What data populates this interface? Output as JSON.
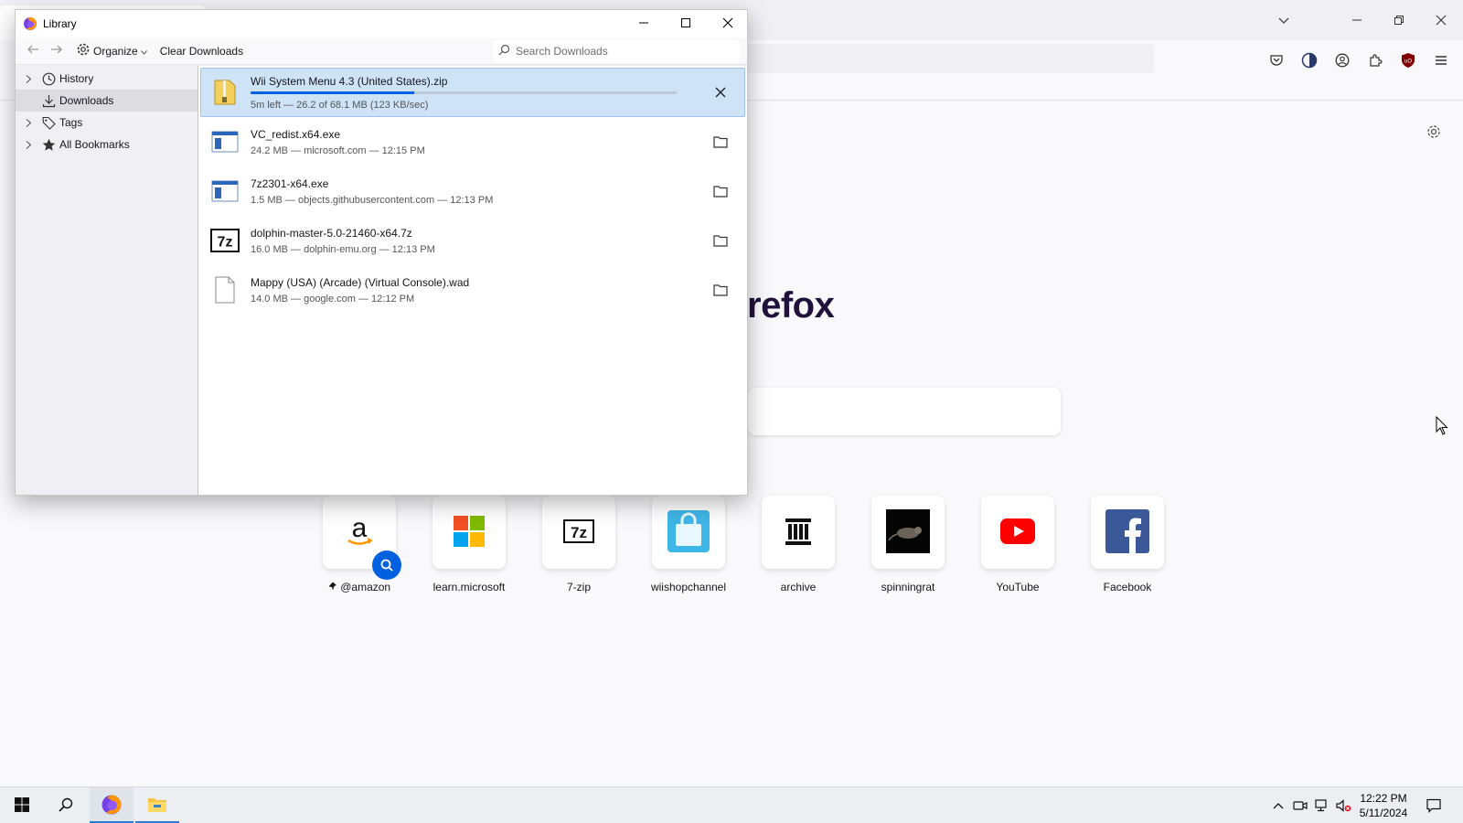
{
  "browser": {
    "logo_text": "refox",
    "shortcuts": [
      {
        "label": "@amazon",
        "icon": "amazon-logo-icon",
        "pinned": true
      },
      {
        "label": "learn.microsoft",
        "icon": "microsoft-logo-icon"
      },
      {
        "label": "7-zip",
        "icon": "7zip-logo-icon"
      },
      {
        "label": "wiishopchannel",
        "icon": "shopping-bag-icon"
      },
      {
        "label": "archive",
        "icon": "archive-building-icon"
      },
      {
        "label": "spinningrat",
        "icon": "rat-image-icon"
      },
      {
        "label": "YouTube",
        "icon": "youtube-logo-icon"
      },
      {
        "label": "Facebook",
        "icon": "facebook-logo-icon"
      }
    ]
  },
  "library": {
    "title": "Library",
    "toolbar": {
      "organize_label": "Organize",
      "clear_label": "Clear Downloads",
      "search_placeholder": "Search Downloads"
    },
    "sidebar": [
      {
        "label": "History",
        "icon": "clock-icon",
        "expandable": true
      },
      {
        "label": "Downloads",
        "icon": "download-icon",
        "expandable": false,
        "selected": true
      },
      {
        "label": "Tags",
        "icon": "tag-icon",
        "expandable": true
      },
      {
        "label": "All Bookmarks",
        "icon": "star-icon",
        "expandable": true
      }
    ],
    "downloads": [
      {
        "name": "Wii System Menu 4.3 (United States).zip",
        "status": "5m left — 26.2 of 68.1 MB (123 KB/sec)",
        "progress": 0.385,
        "icon": "zip-file-icon",
        "active": true
      },
      {
        "name": "VC_redist.x64.exe",
        "status": "24.2 MB — microsoft.com — 12:15 PM",
        "icon": "exe-file-icon"
      },
      {
        "name": "7z2301-x64.exe",
        "status": "1.5 MB — objects.githubusercontent.com — 12:13 PM",
        "icon": "exe-file-icon"
      },
      {
        "name": "dolphin-master-5.0-21460-x64.7z",
        "status": "16.0 MB — dolphin-emu.org — 12:13 PM",
        "icon": "7z-file-icon"
      },
      {
        "name": "Mappy (USA) (Arcade) (Virtual Console).wad",
        "status": "14.0 MB — google.com — 12:12 PM",
        "icon": "blank-file-icon"
      }
    ]
  },
  "taskbar": {
    "time": "12:22 PM",
    "date": "5/11/2024"
  },
  "colors": {
    "accent": "#0061e0",
    "selected_row": "#cfe3f7"
  }
}
